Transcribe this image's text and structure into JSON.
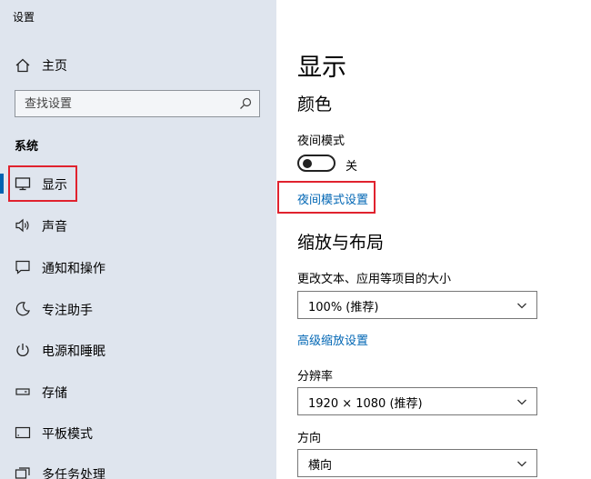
{
  "app": {
    "title": "设置"
  },
  "sidebar": {
    "home_label": "主页",
    "search_placeholder": "查找设置",
    "section_label": "系统",
    "items": [
      {
        "label": "显示",
        "icon": "monitor-icon",
        "selected": true
      },
      {
        "label": "声音",
        "icon": "speaker-icon"
      },
      {
        "label": "通知和操作",
        "icon": "notification-icon"
      },
      {
        "label": "专注助手",
        "icon": "moon-icon"
      },
      {
        "label": "电源和睡眠",
        "icon": "power-icon"
      },
      {
        "label": "存储",
        "icon": "storage-icon"
      },
      {
        "label": "平板模式",
        "icon": "tablet-icon"
      },
      {
        "label": "多任务处理",
        "icon": "multitask-icon"
      }
    ]
  },
  "main": {
    "title": "显示",
    "color_section": {
      "heading": "颜色",
      "night_light_label": "夜间模式",
      "night_light_state": "关",
      "night_light_on": false,
      "night_light_settings_link": "夜间模式设置"
    },
    "scale_section": {
      "heading": "缩放与布局",
      "scale_label": "更改文本、应用等项目的大小",
      "scale_value": "100% (推荐)",
      "advanced_scaling_link": "高级缩放设置",
      "resolution_label": "分辨率",
      "resolution_value": "1920 × 1080 (推荐)",
      "orientation_label": "方向",
      "orientation_value": "横向"
    }
  },
  "colors": {
    "sidebar_bg": "#dfe5ee",
    "accent": "#0063b1",
    "link": "#0066b4",
    "annotation_red": "#e0222e"
  }
}
